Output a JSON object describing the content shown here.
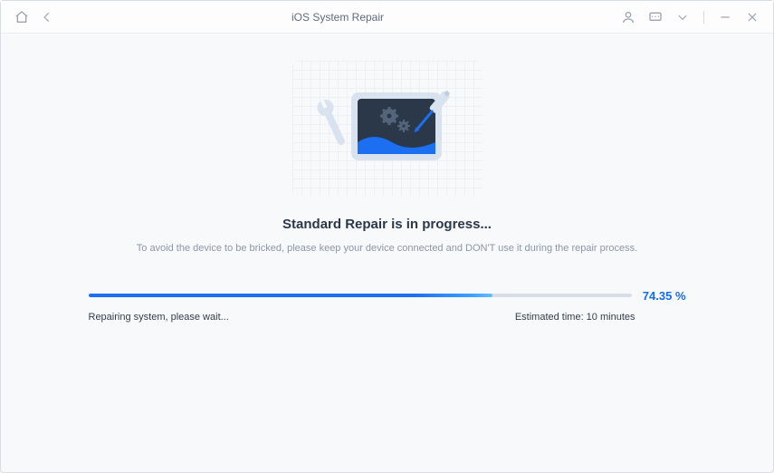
{
  "titlebar": {
    "title": "iOS System Repair"
  },
  "main": {
    "heading": "Standard Repair is in progress...",
    "subtext": "To avoid the device to be bricked, please keep your device connected and DON'T use it during the repair process."
  },
  "progress": {
    "percent_label": "74.35 %",
    "percent_value": 74.35,
    "status": "Repairing system, please wait...",
    "estimated_time": "Estimated time: 10 minutes",
    "fill_width": "74.35%"
  },
  "colors": {
    "accent": "#136cf1",
    "device_screen": "#2a3849"
  }
}
